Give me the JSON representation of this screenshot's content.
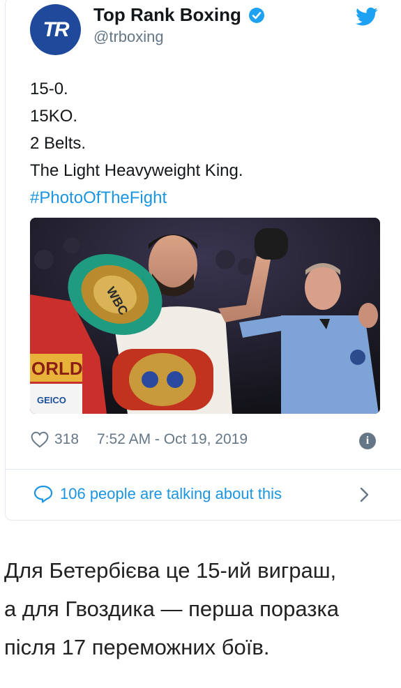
{
  "tweet": {
    "avatar_text": "TR",
    "author_name": "Top Rank Boxing",
    "handle": "@trboxing",
    "lines": [
      "15-0.",
      "15KO.",
      "2 Belts.",
      "The Light Heavyweight King."
    ],
    "hashtag": "#PhotoOfTheFight",
    "photo": {
      "ring_sign": "ORLD",
      "sponsor": "GEICO",
      "belt1": "WBC"
    },
    "likes": "318",
    "timestamp": "7:52 AM - Oct 19, 2019",
    "talking": "106 people are talking about this"
  },
  "caption": {
    "lines": [
      "Для Бетербієва це 15-ий виграш,",
      "а для Гвоздика — перша поразка",
      "після 17 переможних боїв."
    ]
  },
  "colors": {
    "link": "#1b95e0",
    "muted": "#657786",
    "avatar": "#1f4a9c",
    "verified": "#1da1f2"
  },
  "icons": [
    "twitter-bird-icon",
    "verified-icon",
    "heart-icon",
    "info-icon",
    "speech-bubble-icon",
    "chevron-right-icon"
  ]
}
